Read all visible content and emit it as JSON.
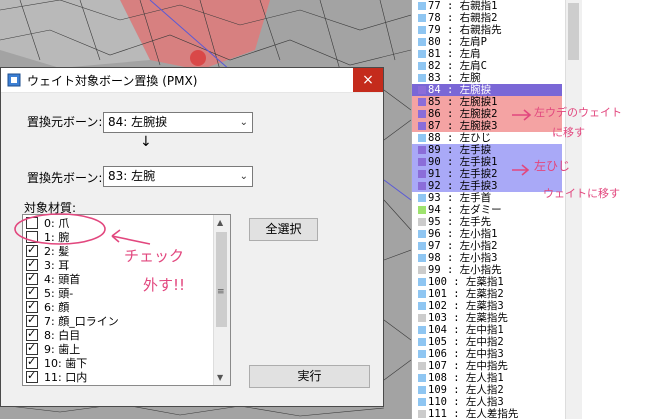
{
  "dialog": {
    "title": "ウェイト対象ボーン置換 (PMX)",
    "close_glyph": "×",
    "source_label": "置換元ボーン:",
    "source_value": "84: 左腕捩",
    "arrow": "↓",
    "dest_label": "置換先ボーン:",
    "dest_value": "83: 左腕",
    "materials_label": "対象材質:",
    "materials": [
      {
        "label": "0: 爪",
        "checked": false
      },
      {
        "label": "1: 腕",
        "checked": false
      },
      {
        "label": "2: 髪",
        "checked": true
      },
      {
        "label": "3: 耳",
        "checked": true
      },
      {
        "label": "4: 頭首",
        "checked": true
      },
      {
        "label": "5: 頭-",
        "checked": true
      },
      {
        "label": "6: 顔",
        "checked": true
      },
      {
        "label": "7: 顔_口ライン",
        "checked": true
      },
      {
        "label": "8: 白目",
        "checked": true
      },
      {
        "label": "9: 歯上",
        "checked": true
      },
      {
        "label": "10: 歯下",
        "checked": true
      },
      {
        "label": "11: 口内",
        "checked": true
      }
    ],
    "select_all_label": "全選択",
    "execute_label": "実行"
  },
  "bones": [
    {
      "label": "77 : 右親指1",
      "sq": "#8fc6f2"
    },
    {
      "label": "78 : 右親指2",
      "sq": "#8fc6f2"
    },
    {
      "label": "79 : 右親指先",
      "sq": "#8fc6f2"
    },
    {
      "label": "80 : 左肩P",
      "sq": "#8fc6f2"
    },
    {
      "label": "81 : 左肩",
      "sq": "#8fc6f2"
    },
    {
      "label": "82 : 左肩C",
      "sq": "#8fc6f2"
    },
    {
      "label": "83 : 左腕",
      "sq": "#8fc6f2"
    },
    {
      "label": "84 : 左腕捩",
      "sq": "#8b6dd9",
      "bg": "#7a67d6",
      "fg": "#ffffff"
    },
    {
      "label": "85 : 左腕捩1",
      "sq": "#8b6dd9",
      "bg": "#f4a3a3"
    },
    {
      "label": "86 : 左腕捩2",
      "sq": "#8b6dd9",
      "bg": "#f4a3a3"
    },
    {
      "label": "87 : 左腕捩3",
      "sq": "#8b6dd9",
      "bg": "#f4a3a3"
    },
    {
      "label": "88 : 左ひじ",
      "sq": "#8fc6f2"
    },
    {
      "label": "89 : 左手捩",
      "sq": "#8b6dd9",
      "bg": "#a9a9f7"
    },
    {
      "label": "90 : 左手捩1",
      "sq": "#8b6dd9",
      "bg": "#a9a9f7"
    },
    {
      "label": "91 : 左手捩2",
      "sq": "#8b6dd9",
      "bg": "#a9a9f7"
    },
    {
      "label": "92 : 左手捩3",
      "sq": "#8b6dd9",
      "bg": "#a9a9f7"
    },
    {
      "label": "93 : 左手首",
      "sq": "#8fc6f2"
    },
    {
      "label": "94 : 左ダミー",
      "sq": "#9ee36e"
    },
    {
      "label": "95 : 左手先",
      "sq": "#cccccc"
    },
    {
      "label": "96 : 左小指1",
      "sq": "#8fc6f2"
    },
    {
      "label": "97 : 左小指2",
      "sq": "#8fc6f2"
    },
    {
      "label": "98 : 左小指3",
      "sq": "#8fc6f2"
    },
    {
      "label": "99 : 左小指先",
      "sq": "#cccccc"
    },
    {
      "label": "100 : 左薬指1",
      "sq": "#8fc6f2"
    },
    {
      "label": "101 : 左薬指2",
      "sq": "#8fc6f2"
    },
    {
      "label": "102 : 左薬指3",
      "sq": "#8fc6f2"
    },
    {
      "label": "103 : 左薬指先",
      "sq": "#cccccc"
    },
    {
      "label": "104 : 左中指1",
      "sq": "#8fc6f2"
    },
    {
      "label": "105 : 左中指2",
      "sq": "#8fc6f2"
    },
    {
      "label": "106 : 左中指3",
      "sq": "#8fc6f2"
    },
    {
      "label": "107 : 左中指先",
      "sq": "#cccccc"
    },
    {
      "label": "108 : 左人指1",
      "sq": "#8fc6f2"
    },
    {
      "label": "109 : 左人指2",
      "sq": "#8fc6f2"
    },
    {
      "label": "110 : 左人指3",
      "sq": "#8fc6f2"
    },
    {
      "label": "111 : 左人差指先",
      "sq": "#cccccc"
    }
  ],
  "annotations": {
    "check_note_1": "チェック",
    "check_note_2": "外す!!",
    "upper_note_1": "左ウデのウェイト",
    "upper_note_2": "に移す",
    "lower_note_1": "左ひじ",
    "lower_note_2": "ウェイトに移す",
    "color": "#e2477e"
  }
}
